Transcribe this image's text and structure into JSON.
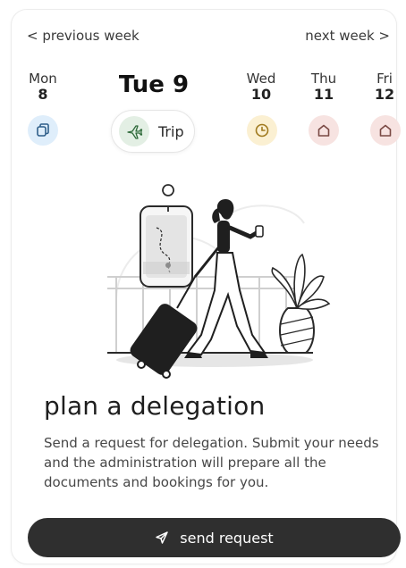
{
  "nav": {
    "prev_label": "< previous week",
    "next_label": "next week >"
  },
  "days": [
    {
      "name": "Mon",
      "num": "8",
      "icon": "copy-icon",
      "color": "#dfeefb",
      "stroke": "#2f5f8a"
    },
    {
      "label": "Tue 9",
      "selected": true
    },
    {
      "name": "Wed",
      "num": "10",
      "icon": "clock-icon",
      "color": "#fbf0d2",
      "stroke": "#a07a1f"
    },
    {
      "name": "Thu",
      "num": "11",
      "icon": "home-icon",
      "color": "#f7e3e1",
      "stroke": "#7a4a44"
    },
    {
      "name": "Fri",
      "num": "12",
      "icon": "home-icon",
      "color": "#f7e3e1",
      "stroke": "#7a4a44"
    }
  ],
  "trip": {
    "label": "Trip",
    "icon": "plane-icon",
    "color": "#e3efe4"
  },
  "main": {
    "heading": "plan a delegation",
    "description": "Send a request for delegation. Submit your needs and the administration will prepare all the documents and bookings for you."
  },
  "cta": {
    "label": "send request",
    "icon": "send-icon",
    "color": "#2f2f2f"
  }
}
